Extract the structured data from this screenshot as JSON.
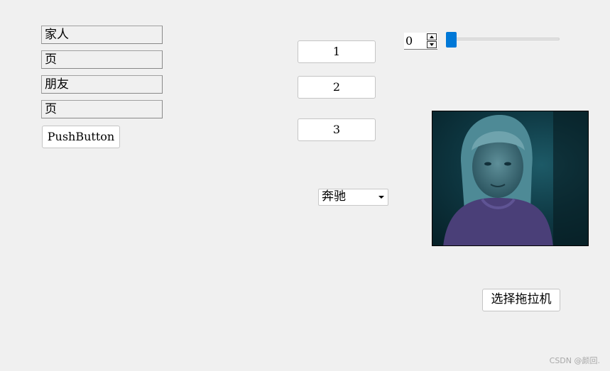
{
  "left_labels": [
    "家人",
    "页",
    "朋友",
    "页"
  ],
  "push_button_label": "PushButton",
  "center_buttons": [
    "1",
    "2",
    "3"
  ],
  "spinbox_value": "0",
  "slider_value": 0,
  "combo_selected": "奔驰",
  "photo_icon": "portrait-photo",
  "select_tractor_button": "选择拖拉机",
  "watermark": "CSDN @颜回."
}
